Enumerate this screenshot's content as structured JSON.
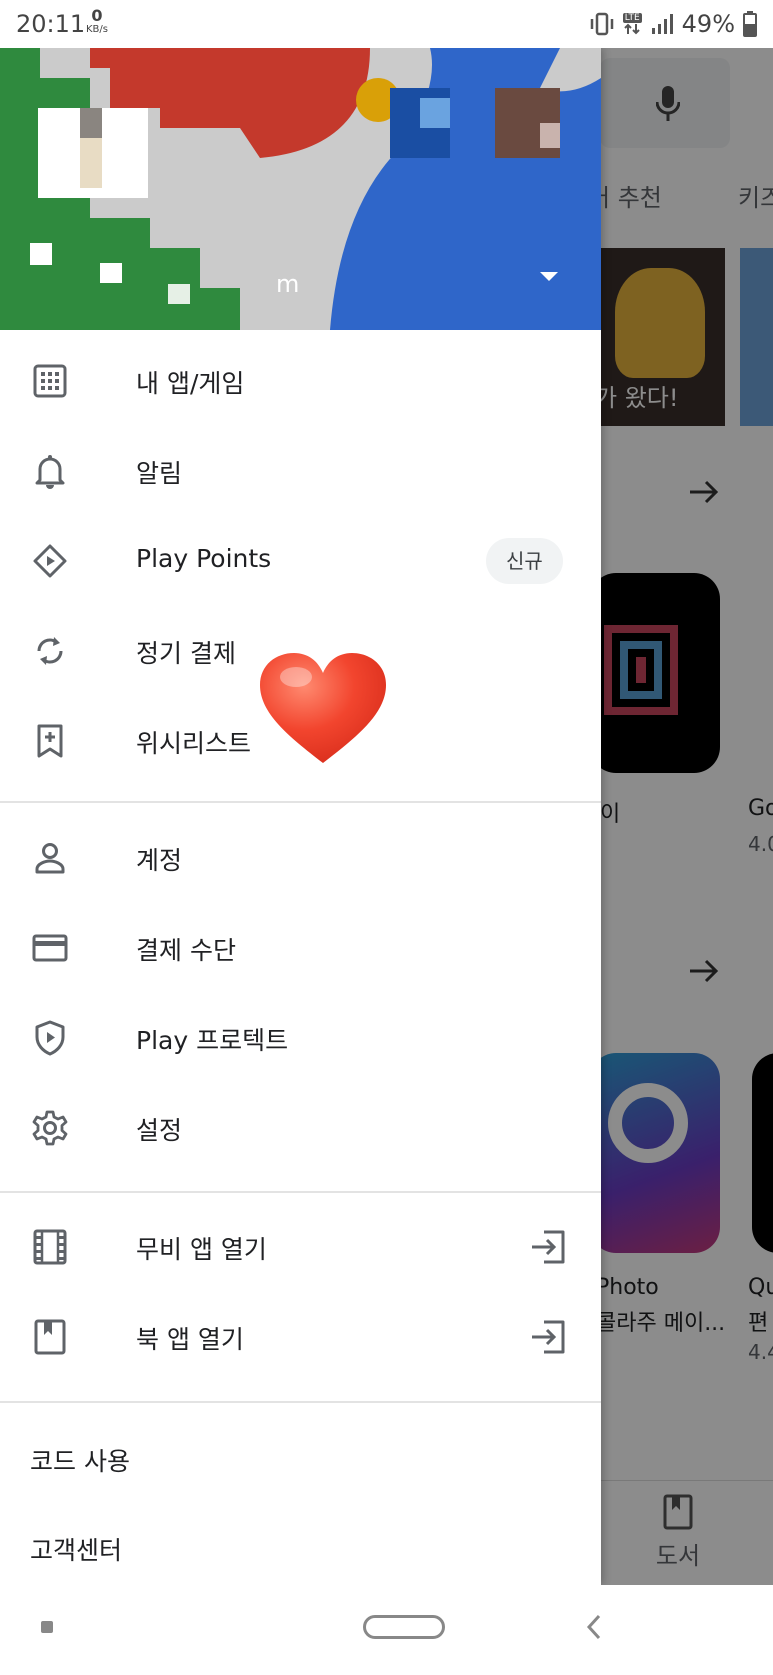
{
  "status_bar": {
    "time": "20:11",
    "speed_value": "0",
    "speed_unit": "KB/s",
    "network": "LTE",
    "battery": "49%"
  },
  "background": {
    "tabs": [
      "어 추천",
      "키즈"
    ],
    "banner_caption": "가 왔다!",
    "app1_name": "이",
    "app2_name": "Go",
    "app2_rating": "4.0",
    "app3_name_line1": "Photo",
    "app3_name_line2": "콜라주 메이...",
    "app4_name_line1": "Qu",
    "app4_name_line2": "편",
    "app4_rating": "4.4",
    "books_tab": "도서"
  },
  "drawer": {
    "account_name": "m",
    "menu_group1": [
      {
        "label": "내 앱/게임",
        "icon": "apps-grid-icon"
      },
      {
        "label": "알림",
        "icon": "bell-icon"
      },
      {
        "label": "Play Points",
        "icon": "play-points-diamond-icon",
        "badge": "신규"
      },
      {
        "label": "정기 결제",
        "icon": "refresh-cycle-icon"
      },
      {
        "label": "위시리스트",
        "icon": "bookmark-add-icon"
      }
    ],
    "menu_group2": [
      {
        "label": "계정",
        "icon": "person-icon"
      },
      {
        "label": "결제 수단",
        "icon": "credit-card-icon"
      },
      {
        "label": "Play 프로텍트",
        "icon": "shield-play-icon"
      },
      {
        "label": "설정",
        "icon": "gear-icon"
      }
    ],
    "menu_group3": [
      {
        "label": "무비 앱 열기",
        "icon": "film-icon",
        "trailing_icon": "open-external-icon"
      },
      {
        "label": "북 앱 열기",
        "icon": "book-icon",
        "trailing_icon": "open-external-icon"
      }
    ],
    "footer_items": [
      "코드 사용",
      "고객센터"
    ]
  },
  "colors": {
    "heart": "#e8402f",
    "icon_gray": "#5f6368"
  }
}
